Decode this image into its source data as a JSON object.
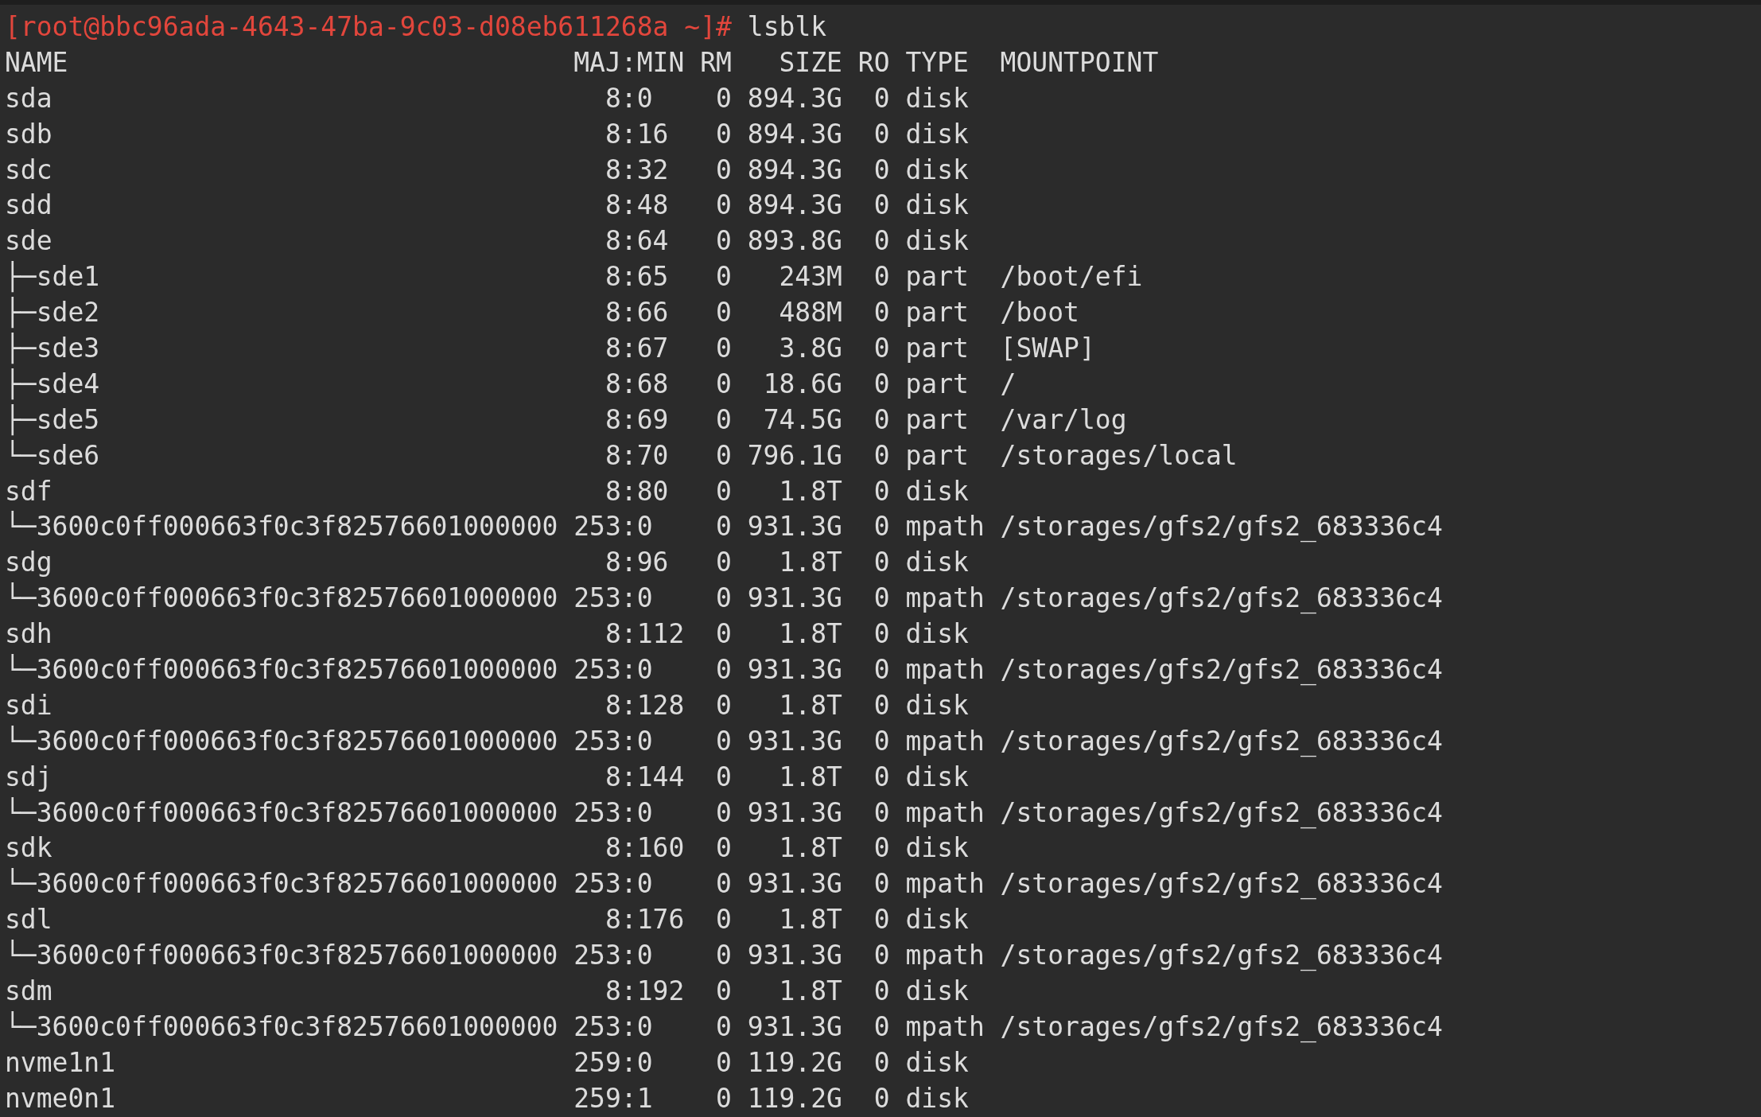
{
  "terminal": {
    "prompt": "[root@bbc96ada-4643-47ba-9c03-d08eb611268a ~]#",
    "command": "lsblk",
    "columns": [
      "NAME",
      "MAJ:MIN",
      "RM",
      "SIZE",
      "RO",
      "TYPE",
      "MOUNTPOINT"
    ],
    "devices": [
      {
        "name": "sda",
        "maj_min": "8:0",
        "rm": "0",
        "size": "894.3G",
        "ro": "0",
        "type": "disk"
      },
      {
        "name": "sdb",
        "maj_min": "8:16",
        "rm": "0",
        "size": "894.3G",
        "ro": "0",
        "type": "disk"
      },
      {
        "name": "sdc",
        "maj_min": "8:32",
        "rm": "0",
        "size": "894.3G",
        "ro": "0",
        "type": "disk"
      },
      {
        "name": "sdd",
        "maj_min": "8:48",
        "rm": "0",
        "size": "894.3G",
        "ro": "0",
        "type": "disk"
      },
      {
        "name": "sde",
        "maj_min": "8:64",
        "rm": "0",
        "size": "893.8G",
        "ro": "0",
        "type": "disk",
        "children": [
          {
            "name": "├─sde1",
            "maj_min": "8:65",
            "rm": "0",
            "size": "243M",
            "ro": "0",
            "type": "part",
            "mountpoint": "/boot/efi"
          },
          {
            "name": "├─sde2",
            "maj_min": "8:66",
            "rm": "0",
            "size": "488M",
            "ro": "0",
            "type": "part",
            "mountpoint": "/boot"
          },
          {
            "name": "├─sde3",
            "maj_min": "8:67",
            "rm": "0",
            "size": "3.8G",
            "ro": "0",
            "type": "part",
            "mountpoint": "[SWAP]"
          },
          {
            "name": "├─sde4",
            "maj_min": "8:68",
            "rm": "0",
            "size": "18.6G",
            "ro": "0",
            "type": "part",
            "mountpoint": "/"
          },
          {
            "name": "├─sde5",
            "maj_min": "8:69",
            "rm": "0",
            "size": "74.5G",
            "ro": "0",
            "type": "part",
            "mountpoint": "/var/log"
          },
          {
            "name": "└─sde6",
            "maj_min": "8:70",
            "rm": "0",
            "size": "796.1G",
            "ro": "0",
            "type": "part",
            "mountpoint": "/storages/local"
          }
        ]
      },
      {
        "name": "sdf",
        "maj_min": "8:80",
        "rm": "0",
        "size": "1.8T",
        "ro": "0",
        "type": "disk",
        "children": [
          {
            "name": "└─3600c0ff000663f0c3f82576601000000",
            "maj_min": "253:0",
            "rm": "0",
            "size": "931.3G",
            "ro": "0",
            "type": "mpath",
            "mountpoint": "/storages/gfs2/gfs2_683336c4"
          }
        ]
      },
      {
        "name": "sdg",
        "maj_min": "8:96",
        "rm": "0",
        "size": "1.8T",
        "ro": "0",
        "type": "disk",
        "children": [
          {
            "name": "└─3600c0ff000663f0c3f82576601000000",
            "maj_min": "253:0",
            "rm": "0",
            "size": "931.3G",
            "ro": "0",
            "type": "mpath",
            "mountpoint": "/storages/gfs2/gfs2_683336c4"
          }
        ]
      },
      {
        "name": "sdh",
        "maj_min": "8:112",
        "rm": "0",
        "size": "1.8T",
        "ro": "0",
        "type": "disk",
        "children": [
          {
            "name": "└─3600c0ff000663f0c3f82576601000000",
            "maj_min": "253:0",
            "rm": "0",
            "size": "931.3G",
            "ro": "0",
            "type": "mpath",
            "mountpoint": "/storages/gfs2/gfs2_683336c4"
          }
        ]
      },
      {
        "name": "sdi",
        "maj_min": "8:128",
        "rm": "0",
        "size": "1.8T",
        "ro": "0",
        "type": "disk",
        "children": [
          {
            "name": "└─3600c0ff000663f0c3f82576601000000",
            "maj_min": "253:0",
            "rm": "0",
            "size": "931.3G",
            "ro": "0",
            "type": "mpath",
            "mountpoint": "/storages/gfs2/gfs2_683336c4"
          }
        ]
      },
      {
        "name": "sdj",
        "maj_min": "8:144",
        "rm": "0",
        "size": "1.8T",
        "ro": "0",
        "type": "disk",
        "children": [
          {
            "name": "└─3600c0ff000663f0c3f82576601000000",
            "maj_min": "253:0",
            "rm": "0",
            "size": "931.3G",
            "ro": "0",
            "type": "mpath",
            "mountpoint": "/storages/gfs2/gfs2_683336c4"
          }
        ]
      },
      {
        "name": "sdk",
        "maj_min": "8:160",
        "rm": "0",
        "size": "1.8T",
        "ro": "0",
        "type": "disk",
        "children": [
          {
            "name": "└─3600c0ff000663f0c3f82576601000000",
            "maj_min": "253:0",
            "rm": "0",
            "size": "931.3G",
            "ro": "0",
            "type": "mpath",
            "mountpoint": "/storages/gfs2/gfs2_683336c4"
          }
        ]
      },
      {
        "name": "sdl",
        "maj_min": "8:176",
        "rm": "0",
        "size": "1.8T",
        "ro": "0",
        "type": "disk",
        "children": [
          {
            "name": "└─3600c0ff000663f0c3f82576601000000",
            "maj_min": "253:0",
            "rm": "0",
            "size": "931.3G",
            "ro": "0",
            "type": "mpath",
            "mountpoint": "/storages/gfs2/gfs2_683336c4"
          }
        ]
      },
      {
        "name": "sdm",
        "maj_min": "8:192",
        "rm": "0",
        "size": "1.8T",
        "ro": "0",
        "type": "disk",
        "children": [
          {
            "name": "└─3600c0ff000663f0c3f82576601000000",
            "maj_min": "253:0",
            "rm": "0",
            "size": "931.3G",
            "ro": "0",
            "type": "mpath",
            "mountpoint": "/storages/gfs2/gfs2_683336c4"
          }
        ]
      },
      {
        "name": "nvme1n1",
        "maj_min": "259:0",
        "rm": "0",
        "size": "119.2G",
        "ro": "0",
        "type": "disk"
      },
      {
        "name": "nvme0n1",
        "maj_min": "259:1",
        "rm": "0",
        "size": "119.2G",
        "ro": "0",
        "type": "disk"
      }
    ]
  }
}
